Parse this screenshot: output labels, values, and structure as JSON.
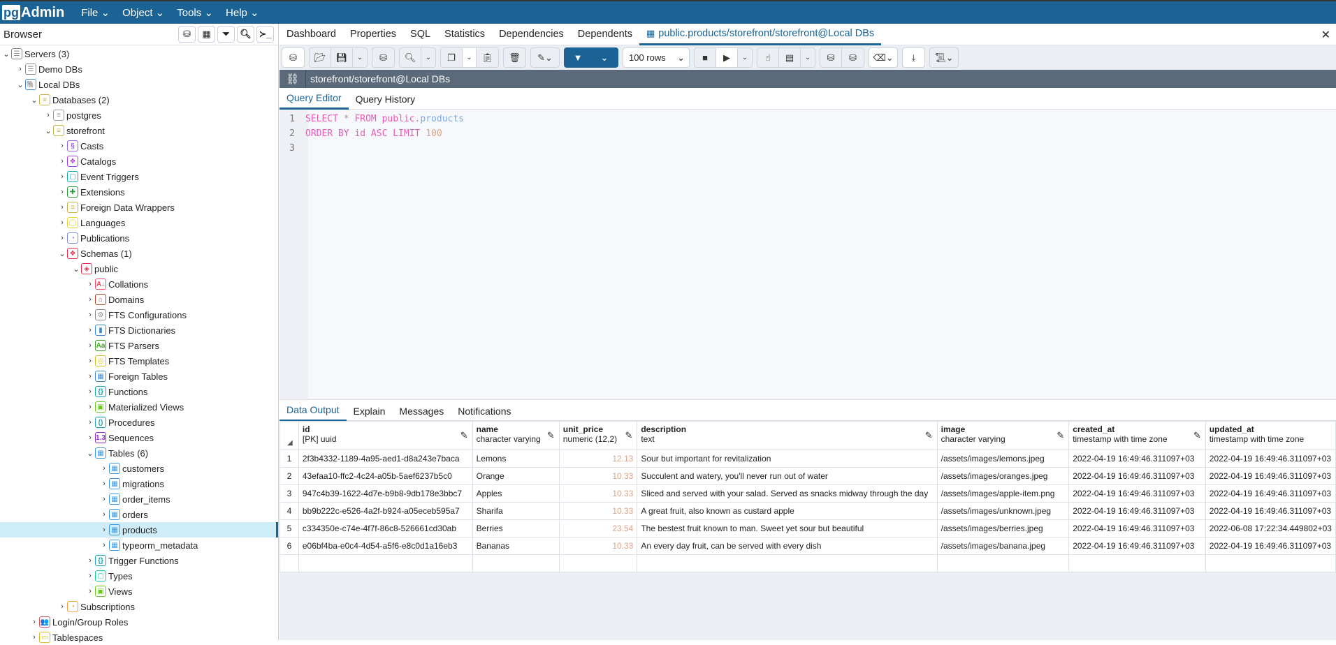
{
  "app": {
    "logo": "pgAdmin",
    "menus": [
      "File",
      "Object",
      "Tools",
      "Help"
    ]
  },
  "browser": {
    "title": "Browser",
    "tools": [
      "query-tool",
      "view-data",
      "filtered-rows",
      "search-objects",
      "psql-tool"
    ]
  },
  "tree": [
    {
      "l": 0,
      "open": true,
      "label": "Servers (3)",
      "icon": "servers-icon",
      "c": "#888",
      "g": "☰"
    },
    {
      "l": 1,
      "open": false,
      "label": "Demo DBs",
      "icon": "server-disconnected-icon",
      "c": "#888",
      "g": "☰"
    },
    {
      "l": 1,
      "open": true,
      "label": "Local DBs",
      "icon": "postgres-elephant-icon",
      "c": "#4a8cc7",
      "g": "🐘"
    },
    {
      "l": 2,
      "open": true,
      "label": "Databases (2)",
      "icon": "databases-icon",
      "c": "#c8b24a",
      "g": "≡"
    },
    {
      "l": 3,
      "open": false,
      "label": "postgres",
      "icon": "database-disconnected-icon",
      "c": "#999",
      "g": "≡"
    },
    {
      "l": 3,
      "open": true,
      "label": "storefront",
      "icon": "database-icon",
      "c": "#c8b24a",
      "g": "≡"
    },
    {
      "l": 4,
      "open": false,
      "label": "Casts",
      "icon": "casts-icon",
      "c": "#9a63d6",
      "g": "§"
    },
    {
      "l": 4,
      "open": false,
      "label": "Catalogs",
      "icon": "catalogs-icon",
      "c": "#a63fd6",
      "g": "❖"
    },
    {
      "l": 4,
      "open": false,
      "label": "Event Triggers",
      "icon": "event-triggers-icon",
      "c": "#19a7b8",
      "g": "▢"
    },
    {
      "l": 4,
      "open": false,
      "label": "Extensions",
      "icon": "extensions-icon",
      "c": "#2a9a3a",
      "g": "✚"
    },
    {
      "l": 4,
      "open": false,
      "label": "Foreign Data Wrappers",
      "icon": "foreign-data-wrappers-icon",
      "c": "#c8b24a",
      "g": "≡"
    },
    {
      "l": 4,
      "open": false,
      "label": "Languages",
      "icon": "languages-icon",
      "c": "#e8d52a",
      "g": "◯"
    },
    {
      "l": 4,
      "open": false,
      "label": "Publications",
      "icon": "publications-icon",
      "c": "#7a8ad6",
      "g": "◔"
    },
    {
      "l": 4,
      "open": true,
      "label": "Schemas (1)",
      "icon": "schemas-icon",
      "c": "#e03050",
      "g": "❖"
    },
    {
      "l": 5,
      "open": true,
      "label": "public",
      "icon": "schema-icon",
      "c": "#e03050",
      "g": "◈"
    },
    {
      "l": 6,
      "open": false,
      "label": "Collations",
      "icon": "collations-icon",
      "c": "#f04a6a",
      "g": "A↓"
    },
    {
      "l": 6,
      "open": false,
      "label": "Domains",
      "icon": "domains-icon",
      "c": "#b05030",
      "g": "⌂"
    },
    {
      "l": 6,
      "open": false,
      "label": "FTS Configurations",
      "icon": "fts-configurations-icon",
      "c": "#888",
      "g": "⚙"
    },
    {
      "l": 6,
      "open": false,
      "label": "FTS Dictionaries",
      "icon": "fts-dictionaries-icon",
      "c": "#3a8ad0",
      "g": "▮"
    },
    {
      "l": 6,
      "open": false,
      "label": "FTS Parsers",
      "icon": "fts-parsers-icon",
      "c": "#3aa520",
      "g": "Aa"
    },
    {
      "l": 6,
      "open": false,
      "label": "FTS Templates",
      "icon": "fts-templates-icon",
      "c": "#d4c020",
      "g": "◎"
    },
    {
      "l": 6,
      "open": false,
      "label": "Foreign Tables",
      "icon": "foreign-tables-icon",
      "c": "#3a8ad0",
      "g": "▦"
    },
    {
      "l": 6,
      "open": false,
      "label": "Functions",
      "icon": "functions-icon",
      "c": "#19a7b8",
      "g": "{}"
    },
    {
      "l": 6,
      "open": false,
      "label": "Materialized Views",
      "icon": "materialized-views-icon",
      "c": "#6ac81a",
      "g": "▣"
    },
    {
      "l": 6,
      "open": false,
      "label": "Procedures",
      "icon": "procedures-icon",
      "c": "#19a7b8",
      "g": "()"
    },
    {
      "l": 6,
      "open": false,
      "label": "Sequences",
      "icon": "sequences-icon",
      "c": "#9a2ad6",
      "g": "1.3"
    },
    {
      "l": 6,
      "open": true,
      "label": "Tables (6)",
      "icon": "tables-icon",
      "c": "#3a9ae0",
      "g": "▦"
    },
    {
      "l": 7,
      "open": false,
      "label": "customers",
      "icon": "table-icon",
      "c": "#3a9ae0",
      "g": "▦"
    },
    {
      "l": 7,
      "open": false,
      "label": "migrations",
      "icon": "table-icon",
      "c": "#3a9ae0",
      "g": "▦"
    },
    {
      "l": 7,
      "open": false,
      "label": "order_items",
      "icon": "table-icon",
      "c": "#3a9ae0",
      "g": "▦"
    },
    {
      "l": 7,
      "open": false,
      "label": "orders",
      "icon": "table-icon",
      "c": "#3a9ae0",
      "g": "▦"
    },
    {
      "l": 7,
      "open": false,
      "label": "products",
      "icon": "table-icon",
      "c": "#3a9ae0",
      "g": "▦",
      "selected": true
    },
    {
      "l": 7,
      "open": false,
      "label": "typeorm_metadata",
      "icon": "table-icon",
      "c": "#3a9ae0",
      "g": "▦"
    },
    {
      "l": 6,
      "open": false,
      "label": "Trigger Functions",
      "icon": "trigger-functions-icon",
      "c": "#19a7b8",
      "g": "{}"
    },
    {
      "l": 6,
      "open": false,
      "label": "Types",
      "icon": "types-icon",
      "c": "#19c8a0",
      "g": "▢"
    },
    {
      "l": 6,
      "open": false,
      "label": "Views",
      "icon": "views-icon",
      "c": "#6ac81a",
      "g": "▣"
    },
    {
      "l": 4,
      "open": false,
      "label": "Subscriptions",
      "icon": "subscriptions-icon",
      "c": "#f0a040",
      "g": "◔"
    },
    {
      "l": 2,
      "open": false,
      "label": "Login/Group Roles",
      "icon": "roles-icon",
      "c": "#e05060",
      "g": "👥"
    },
    {
      "l": 2,
      "open": false,
      "label": "Tablespaces",
      "icon": "tablespaces-icon",
      "c": "#d4c020",
      "g": "▭"
    }
  ],
  "tabs": [
    "Dashboard",
    "Properties",
    "SQL",
    "Statistics",
    "Dependencies",
    "Dependents",
    "public.products/storefront/storefront@Local DBs"
  ],
  "toolbar": {
    "rows": "100 rows"
  },
  "connection": "storefront/storefront@Local DBs",
  "query_tabs": [
    "Query Editor",
    "Query History"
  ],
  "editor": {
    "line_numbers": [
      "1",
      "2",
      "3"
    ],
    "l1": {
      "a": "SELECT",
      "b": " * ",
      "c": "FROM",
      "d": " public.",
      "e": "products"
    },
    "l2": {
      "a": "ORDER BY id ASC LIMIT ",
      "b": "100"
    }
  },
  "result_tabs": [
    "Data Output",
    "Explain",
    "Messages",
    "Notifications"
  ],
  "grid": {
    "columns": [
      {
        "name": "id",
        "type": "[PK] uuid"
      },
      {
        "name": "name",
        "type": "character varying"
      },
      {
        "name": "unit_price",
        "type": "numeric (12,2)"
      },
      {
        "name": "description",
        "type": "text"
      },
      {
        "name": "image",
        "type": "character varying"
      },
      {
        "name": "created_at",
        "type": "timestamp with time zone"
      },
      {
        "name": "updated_at",
        "type": "timestamp with time zone"
      }
    ],
    "rows": [
      [
        "1",
        "2f3b4332-1189-4a95-aed1-d8a243e7baca",
        "Lemons",
        "12.13",
        "Sour but important for revitalization",
        "/assets/images/lemons.jpeg",
        "2022-04-19 16:49:46.311097+03",
        "2022-04-19 16:49:46.311097+03"
      ],
      [
        "2",
        "43efaa10-ffc2-4c24-a05b-5aef6237b5c0",
        "Orange",
        "10.33",
        "Succulent and watery, you'll never run out of water",
        "/assets/images/oranges.jpeg",
        "2022-04-19 16:49:46.311097+03",
        "2022-04-19 16:49:46.311097+03"
      ],
      [
        "3",
        "947c4b39-1622-4d7e-b9b8-9db178e3bbc7",
        "Apples",
        "10.33",
        "Sliced and served with your salad. Served as snacks midway through the day",
        "/assets/images/apple-item.png",
        "2022-04-19 16:49:46.311097+03",
        "2022-04-19 16:49:46.311097+03"
      ],
      [
        "4",
        "bb9b222c-e526-4a2f-b924-a05eceb595a7",
        "Sharifa",
        "10.33",
        "A great fruit, also known as custard apple",
        "/assets/images/unknown.jpeg",
        "2022-04-19 16:49:46.311097+03",
        "2022-04-19 16:49:46.311097+03"
      ],
      [
        "5",
        "c334350e-c74e-4f7f-86c8-526661cd30ab",
        "Berries",
        "23.54",
        "The bestest fruit known to man. Sweet yet sour but beautiful",
        "/assets/images/berries.jpeg",
        "2022-04-19 16:49:46.311097+03",
        "2022-06-08 17:22:34.449802+03"
      ],
      [
        "6",
        "e06bf4ba-e0c4-4d54-a5f6-e8c0d1a16eb3",
        "Bananas",
        "10.33",
        "An every day fruit, can be served with every dish",
        "/assets/images/banana.jpeg",
        "2022-04-19 16:49:46.311097+03",
        "2022-04-19 16:49:46.311097+03"
      ]
    ]
  }
}
